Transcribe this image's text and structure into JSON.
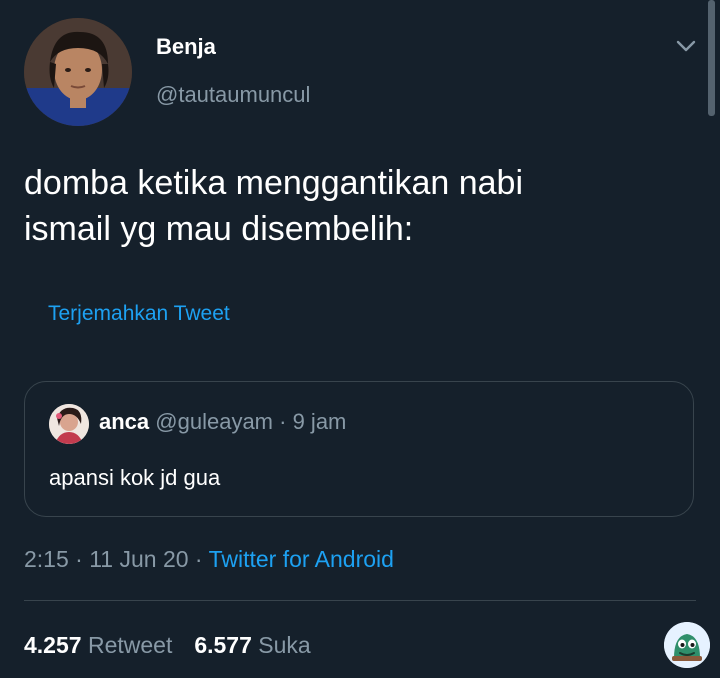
{
  "author": {
    "display_name": "Benja",
    "handle": "@tautaumuncul"
  },
  "tweet": {
    "text_lines": [
      "domba ketika menggantikan nabi",
      "ismail yg mau disembelih:"
    ],
    "translate_label": "Terjemahkan Tweet"
  },
  "quote": {
    "name": "anca",
    "handle": "@guleayam",
    "separator": " · ",
    "time": "9 jam",
    "text": "apansi kok jd gua"
  },
  "meta": {
    "time": "2:15",
    "separator": " · ",
    "date": "11 Jun 20",
    "source": "Twitter for Android"
  },
  "stats": {
    "retweets_count": "4.257",
    "retweets_label": "Retweet",
    "likes_count": "6.577",
    "likes_label": "Suka"
  },
  "colors": {
    "background": "#15202b",
    "accent": "#1da1f2",
    "secondary_text": "#8899a6",
    "border": "#38444d"
  },
  "icons": {
    "menu": "chevron-down-icon",
    "fab": "mascot-icon"
  }
}
